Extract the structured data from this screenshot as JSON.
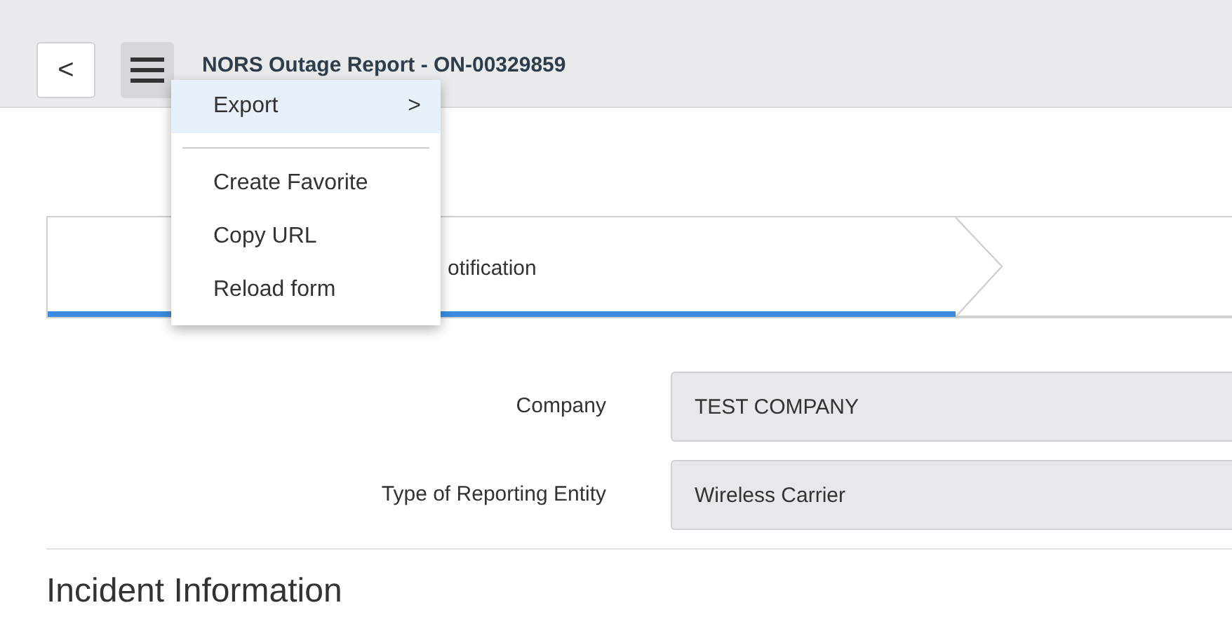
{
  "header": {
    "back": "<",
    "title": "NORS Outage Report - ON-00329859"
  },
  "menu": {
    "items": [
      {
        "label": "Export",
        "kind": "submenu",
        "selected": true,
        "arrow": ">"
      },
      {
        "kind": "divider"
      },
      {
        "label": "Create Favorite",
        "kind": "item",
        "selected": false
      },
      {
        "label": "Copy URL",
        "kind": "item",
        "selected": false
      },
      {
        "label": "Reload form",
        "kind": "item",
        "selected": false
      }
    ]
  },
  "stages": [
    {
      "label": "otification",
      "selected": true
    },
    {
      "selected": false
    }
  ],
  "fields": [
    {
      "label": "Company",
      "value": "TEST COMPANY"
    },
    {
      "label": "Type of Reporting Entity",
      "value": "Wireless Carrier"
    }
  ],
  "section": {
    "title": "Incident Information"
  }
}
